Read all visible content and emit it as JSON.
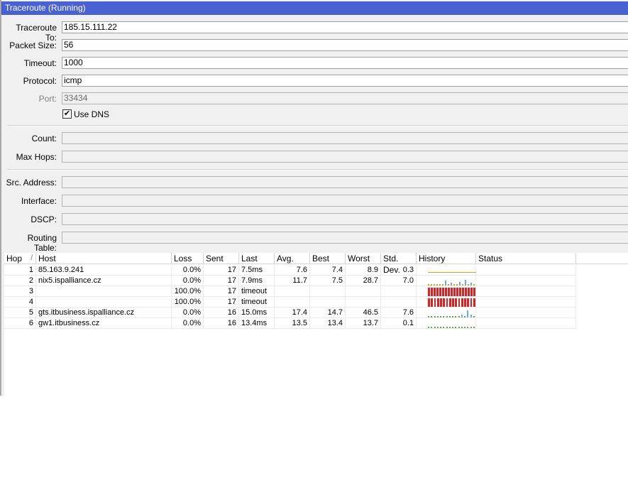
{
  "window": {
    "title": "Traceroute (Running)"
  },
  "form": {
    "traceroute_to": {
      "label": "Traceroute To:",
      "value": "185.15.111.22"
    },
    "packet_size": {
      "label": "Packet Size:",
      "value": "56"
    },
    "timeout": {
      "label": "Timeout:",
      "value": "1000"
    },
    "protocol": {
      "label": "Protocol:",
      "value": "icmp"
    },
    "port": {
      "label": "Port:",
      "value": "33434"
    },
    "use_dns": {
      "label": "Use DNS",
      "checked": true
    },
    "count": {
      "label": "Count:",
      "value": ""
    },
    "max_hops": {
      "label": "Max Hops:",
      "value": ""
    },
    "src_address": {
      "label": "Src. Address:",
      "value": ""
    },
    "interface": {
      "label": "Interface:",
      "value": ""
    },
    "dscp": {
      "label": "DSCP:",
      "value": ""
    },
    "routing_table": {
      "label": "Routing Table:",
      "value": ""
    }
  },
  "table": {
    "columns": [
      "Hop",
      "Host",
      "Loss",
      "Sent",
      "Last",
      "Avg.",
      "Best",
      "Worst",
      "Std. Dev.",
      "History",
      "Status"
    ],
    "sort_indicator": "/",
    "rows": [
      {
        "hop": "1",
        "host": "85.163.9.241",
        "loss": "0.0%",
        "sent": "17",
        "last": "7.5ms",
        "avg": "7.6",
        "best": "7.4",
        "worst": "8.9",
        "std": "0.3",
        "status": "",
        "history": {
          "kind": "line",
          "color": "#d4a017",
          "levels": [
            0.1,
            0.1,
            0.1,
            0.1,
            0.1,
            0.1,
            0.1,
            0.1,
            0.2,
            0.1,
            0.1,
            0.1,
            0.1,
            0.1,
            0.1,
            0.1,
            0.1
          ]
        }
      },
      {
        "hop": "2",
        "host": "nix5.ispalliance.cz",
        "loss": "0.0%",
        "sent": "17",
        "last": "7.9ms",
        "avg": "11.7",
        "best": "7.5",
        "worst": "28.7",
        "std": "7.0",
        "status": "",
        "history": {
          "kind": "mixed",
          "color": "#d4a017",
          "accent": "#6fa8dc",
          "levels": [
            0.1,
            0.1,
            0.1,
            0.1,
            0.1,
            0.1,
            0.6,
            0.1,
            0.3,
            0.1,
            0.2,
            0.4,
            0.1,
            0.7,
            0.1,
            0.3,
            0.1
          ]
        }
      },
      {
        "hop": "3",
        "host": "",
        "loss": "100.0%",
        "sent": "17",
        "last": "timeout",
        "avg": "",
        "best": "",
        "worst": "",
        "std": "",
        "status": "",
        "history": {
          "kind": "timeout",
          "color": "#e02020",
          "levels": [
            1,
            1,
            1,
            1,
            1,
            1,
            1,
            1,
            1,
            1,
            1,
            1,
            1,
            1,
            1,
            1,
            1
          ]
        }
      },
      {
        "hop": "4",
        "host": "",
        "loss": "100.0%",
        "sent": "17",
        "last": "timeout",
        "avg": "",
        "best": "",
        "worst": "",
        "std": "",
        "status": "",
        "history": {
          "kind": "timeout",
          "color": "#e02020",
          "levels": [
            1,
            1,
            1,
            1,
            1,
            1,
            1,
            1,
            1,
            1,
            1,
            1,
            1,
            1,
            1,
            1
          ]
        }
      },
      {
        "hop": "5",
        "host": "gts.itbusiness.ispalliance.cz",
        "loss": "0.0%",
        "sent": "16",
        "last": "15.0ms",
        "avg": "17.4",
        "best": "14.7",
        "worst": "46.5",
        "std": "7.6",
        "status": "",
        "history": {
          "kind": "mixed",
          "color": "#6aa84f",
          "accent": "#6fa8dc",
          "levels": [
            0.2,
            0.2,
            0.2,
            0.2,
            0.2,
            0.2,
            0.2,
            0.2,
            0.2,
            0.2,
            0.2,
            0.3,
            0.2,
            0.8,
            0.3,
            0.2
          ]
        }
      },
      {
        "hop": "6",
        "host": "gw1.itbusiness.cz",
        "loss": "0.0%",
        "sent": "16",
        "last": "13.4ms",
        "avg": "13.5",
        "best": "13.4",
        "worst": "13.7",
        "std": "0.1",
        "status": "",
        "history": {
          "kind": "flat",
          "color": "#6aa84f",
          "levels": [
            0.2,
            0.2,
            0.2,
            0.2,
            0.2,
            0.2,
            0.2,
            0.2,
            0.2,
            0.2,
            0.2,
            0.2,
            0.2,
            0.2,
            0.2,
            0.2
          ]
        }
      }
    ]
  }
}
